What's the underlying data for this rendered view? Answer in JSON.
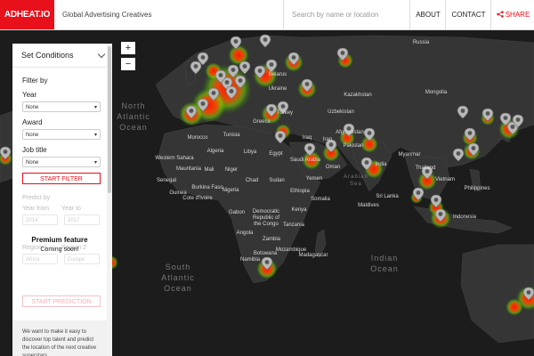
{
  "header": {
    "logo": "ADHEAT.IO",
    "tagline": "Global Advertising Creatives",
    "search_placeholder": "Search by name or location",
    "nav_about": "ABOUT",
    "nav_contact": "CONTACT",
    "nav_share": "SHARE",
    "accent_color": "#e8101a"
  },
  "zoom": {
    "in": "+",
    "out": "−"
  },
  "panel": {
    "title": "Set Conditions",
    "filter_by": "Filter by",
    "year_label": "Year",
    "year_value": "None",
    "award_label": "Award",
    "award_value": "None",
    "job_label": "Job title",
    "job_value": "None",
    "start_filter": "START FILTER",
    "predict_by": "Predict by",
    "year_from_label": "Year from",
    "year_to_label": "Year to",
    "year_from_value": "2014",
    "year_to_value": "2017",
    "region1_label": "Region 1",
    "region2_label": "Region 2",
    "region1_value": "Africa",
    "region2_value": "Europe",
    "premium_title": "Premium feature",
    "premium_sub": "Coming soon!",
    "start_prediction": "START PREDICTION",
    "footer_text": "We want to make it easy to discover top talent and predict the location of the next creative superstars."
  },
  "map": {
    "labels": [
      {
        "text": "Russia"
      },
      {
        "text": "Belarus"
      },
      {
        "text": "Ukraine"
      },
      {
        "text": "Kazakhstan"
      },
      {
        "text": "Uzbekistan"
      },
      {
        "text": "Mongolia"
      },
      {
        "text": "Turkey"
      },
      {
        "text": "Greece"
      },
      {
        "text": "Tunisia"
      },
      {
        "text": "Morocco"
      },
      {
        "text": "Algeria"
      },
      {
        "text": "Libya"
      },
      {
        "text": "Egypt"
      },
      {
        "text": "Iraq"
      },
      {
        "text": "Iran"
      },
      {
        "text": "Afghanistan"
      },
      {
        "text": "Pakistan"
      },
      {
        "text": "Saudi Arabia"
      },
      {
        "text": "Oman"
      },
      {
        "text": "Yemen"
      },
      {
        "text": "India"
      },
      {
        "text": "Western Sahara"
      },
      {
        "text": "Mauritania"
      },
      {
        "text": "Mali"
      },
      {
        "text": "Niger"
      },
      {
        "text": "Chad"
      },
      {
        "text": "Sudan"
      },
      {
        "text": "Senegal"
      },
      {
        "text": "Burkina Faso"
      },
      {
        "text": "Guinea"
      },
      {
        "text": "Cote d'Ivoire"
      },
      {
        "text": "Nigeria"
      },
      {
        "text": "Ethiopia"
      },
      {
        "text": "Somalia"
      },
      {
        "text": "Kenya"
      },
      {
        "text": "Tanzania"
      },
      {
        "text": "Gabon"
      },
      {
        "text": "Democratic"
      },
      {
        "text": "Republic of"
      },
      {
        "text": "the Congo"
      },
      {
        "text": "Angola"
      },
      {
        "text": "Zambia"
      },
      {
        "text": "Namibia"
      },
      {
        "text": "Botswana"
      },
      {
        "text": "Madagascar"
      },
      {
        "text": "Mozambique"
      },
      {
        "text": "Sri Lanka"
      },
      {
        "text": "Maldives"
      },
      {
        "text": "Thailand"
      },
      {
        "text": "Vietnam"
      },
      {
        "text": "Philippines"
      },
      {
        "text": "Indonesia"
      },
      {
        "text": "Myanmar"
      }
    ],
    "oceans": [
      {
        "text": "North"
      },
      {
        "text": "Atlantic"
      },
      {
        "text": "Ocean"
      },
      {
        "text": "South"
      },
      {
        "text": "Atlantic"
      },
      {
        "text": "Ocean"
      },
      {
        "text": "Indian"
      },
      {
        "text": "Ocean"
      },
      {
        "text": "Arabian"
      },
      {
        "text": "Sea"
      }
    ]
  }
}
